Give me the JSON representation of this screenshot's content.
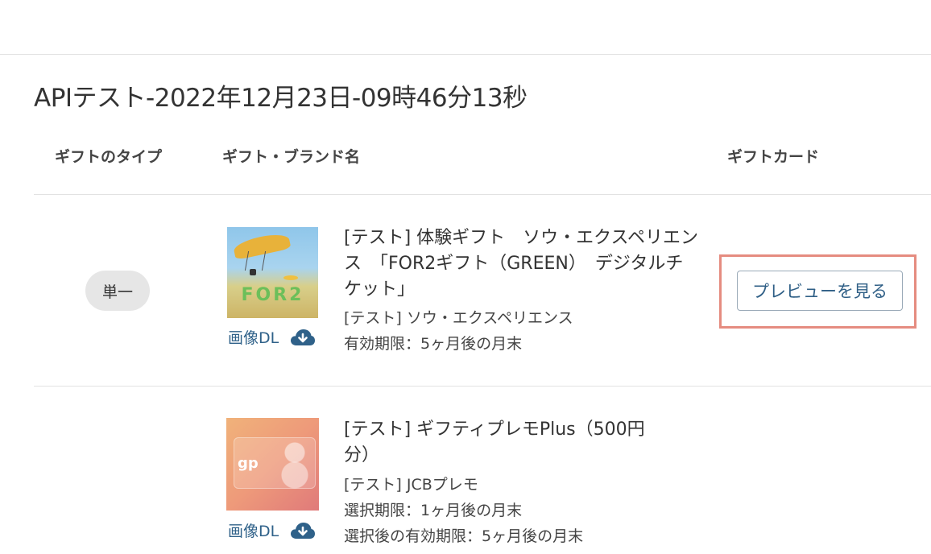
{
  "page": {
    "title": "APIテスト-2022年12月23日-09時46分13秒"
  },
  "table": {
    "headers": {
      "type": "ギフトのタイプ",
      "brand": "ギフト・ブランド名",
      "card": "ギフトカード"
    },
    "rows": [
      {
        "type_badge": "単一",
        "image_dl": "画像DL",
        "thumbnail_text": "FOR2",
        "gift_name": "[テスト] 体験ギフト　ソウ・エクスペリエンス　「FOR2ギフト（GREEN）　デジタルチケット」",
        "brand": "[テスト] ソウ・エクスペリエンス",
        "validity": "有効期限：5ヶ月後の月末",
        "preview_button": "プレビューを見る"
      },
      {
        "image_dl": "画像DL",
        "thumbnail_text": "gp",
        "gift_name": "[テスト] ギフティプレモPlus（500円分）",
        "brand": "[テスト] JCBプレモ",
        "selection_period": "選択期限：1ヶ月後の月末",
        "validity_after": "選択後の有効期限：5ヶ月後の月末"
      }
    ]
  },
  "colors": {
    "link": "#2f6189",
    "highlight": "#e58c80",
    "badge_bg": "#e6e6e6"
  },
  "icons": [
    "cloud-download-icon"
  ]
}
